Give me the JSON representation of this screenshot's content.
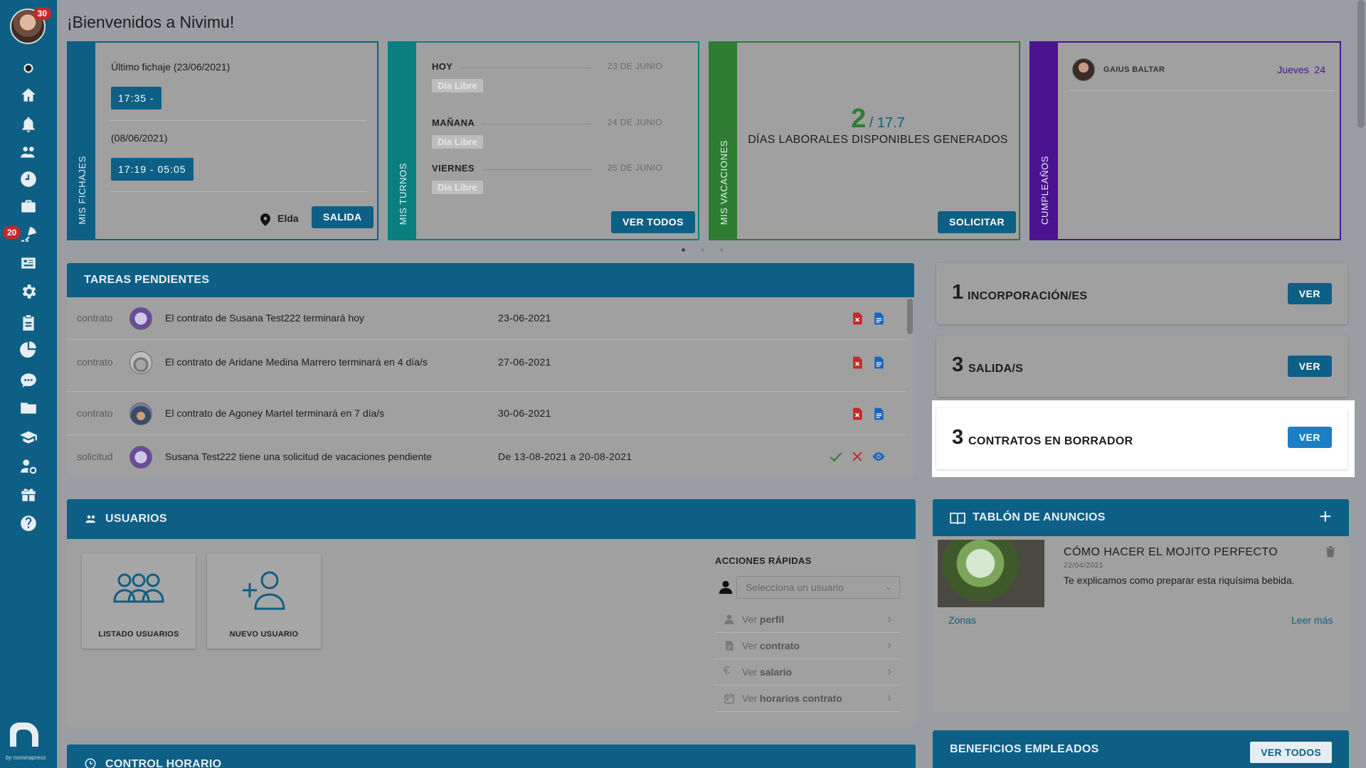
{
  "sidebar": {
    "avatar_badge": "30",
    "item_badge": "20",
    "by_text": "by nominapress",
    "items": [
      "status-dot",
      "home",
      "notifications",
      "users",
      "time",
      "briefcase",
      "vacations",
      "id-card",
      "settings",
      "clipboard",
      "chart",
      "chat",
      "folder",
      "training",
      "user-settings",
      "benefits",
      "help"
    ]
  },
  "page": {
    "title": "¡Bienvenidos a Nivimu!"
  },
  "fichajes": {
    "label": "MIS FICHAJES",
    "last_label": "Último fichaje (23/06/2021)",
    "last_time": "17:35 -",
    "prev_label": "(08/06/2021)",
    "prev_time": "17:19 - 05:05",
    "location": "Elda",
    "button": "SALIDA",
    "color": "#0e5f85"
  },
  "turnos": {
    "label": "MIS TURNOS",
    "rows": [
      {
        "day": "HOY",
        "date": "23 DE JUNIO",
        "status": "Día Libre"
      },
      {
        "day": "MAÑANA",
        "date": "24 DE JUNIO",
        "status": "Día Libre"
      },
      {
        "day": "VIERNES",
        "date": "25 DE JUNIO",
        "status": "Día Libre"
      }
    ],
    "button": "VER TODOS",
    "color": "#0b7f7f"
  },
  "vacaciones": {
    "label": "MIS VACACIONES",
    "available": "2",
    "total": "/ 17.7",
    "description": "DÍAS LABORALES DISPONIBLES GENERADOS",
    "button": "SOLICITAR",
    "color": "#2e7d32"
  },
  "cumpleanos": {
    "label": "CUMPLEAÑOS",
    "name": "GAIUS BALTAR",
    "day": "Jueves",
    "date": "24",
    "color": "#4a1490"
  },
  "tareas": {
    "title": "TAREAS PENDIENTES",
    "rows": [
      {
        "type": "contrato",
        "text": "El contrato de Susana Test222 terminará hoy",
        "date": "23-06-2021",
        "kind": "doc"
      },
      {
        "type": "contrato",
        "text": "El contrato de Aridane Medina Marrero terminará en 4 día/s",
        "date": "27-06-2021",
        "kind": "doc"
      },
      {
        "type": "contrato",
        "text": "El contrato de Agoney Martel terminará en 7 día/s",
        "date": "30-06-2021",
        "kind": "doc"
      },
      {
        "type": "solicitud",
        "text": "Susana Test222 tiene una solicitud de vacaciones pendiente",
        "date": "De 13-08-2021 a 20-08-2021",
        "kind": "approve"
      }
    ]
  },
  "usuarios": {
    "title": "USUARIOS",
    "tiles": [
      "LISTADO USUARIOS",
      "NUEVO USUARIO"
    ],
    "quick_actions": {
      "title": "ACCIONES RÁPIDAS",
      "select_placeholder": "Selecciona un usuario",
      "items": [
        {
          "prefix": "Ver",
          "bold": "perfil",
          "icon": "person-icon"
        },
        {
          "prefix": "Ver",
          "bold": "contrato",
          "icon": "document-icon"
        },
        {
          "prefix": "Ver",
          "bold": "salario",
          "icon": "euro-icon"
        },
        {
          "prefix": "Ver",
          "bold": "horarios contrato",
          "icon": "calendar-icon"
        }
      ]
    }
  },
  "control_horario": {
    "title": "CONTROL HORARIO"
  },
  "stats": [
    {
      "number": "1",
      "label": "INCORPORACIÓN/ES",
      "button": "VER",
      "highlight": false
    },
    {
      "number": "3",
      "label": "SALIDA/S",
      "button": "VER",
      "highlight": false
    },
    {
      "number": "3",
      "label": "CONTRATOS EN BORRADOR",
      "button": "VER",
      "highlight": true
    }
  ],
  "tablon": {
    "title": "TABLÓN DE ANUNCIOS",
    "post": {
      "title": "CÓMO HACER EL MOJITO PERFECTO",
      "date": "22/04/2021",
      "description": "Te explicamos como preparar esta riquísima bebida.",
      "category": "Zonas",
      "more": "Leer más"
    }
  },
  "beneficios": {
    "title": "BENEFICIOS EMPLEADOS",
    "button": "VER TODOS"
  }
}
